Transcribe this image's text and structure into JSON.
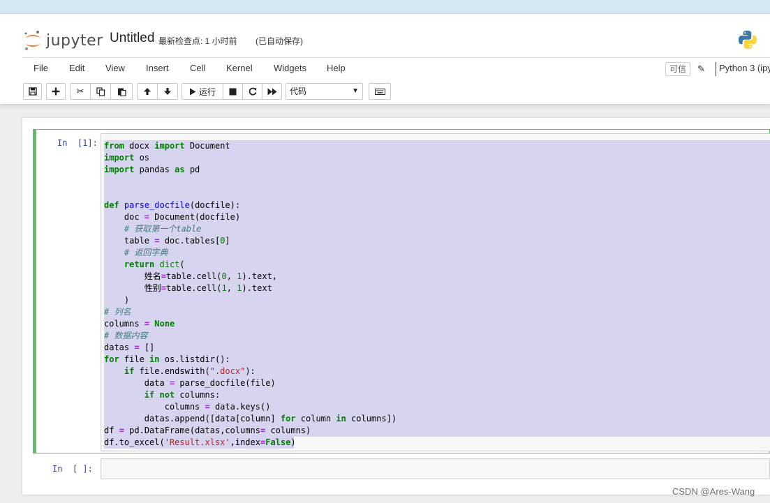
{
  "header": {
    "logo_text": "jupyter",
    "notebook_name": "Untitled",
    "checkpoint": "最新检查点: 1 小时前",
    "autosave": "(已自动保存)"
  },
  "menu": {
    "items": [
      "File",
      "Edit",
      "View",
      "Insert",
      "Cell",
      "Kernel",
      "Widgets",
      "Help"
    ],
    "trusted": "可信",
    "kernel": "Python 3 (ipy"
  },
  "toolbar": {
    "run_label": "运行",
    "cell_type": "代码",
    "icons": [
      "save-icon",
      "add-cell-icon",
      "cut-icon",
      "copy-icon",
      "paste-icon",
      "move-up-icon",
      "move-down-icon",
      "run-icon",
      "stop-icon",
      "restart-icon",
      "fast-forward-icon",
      "keyboard-icon"
    ]
  },
  "cells": [
    {
      "prompt": "In  [1]:",
      "code": [
        "from docx import Document",
        "import os",
        "import pandas as pd",
        "",
        "",
        "def parse_docfile(docfile):",
        "    doc = Document(docfile)",
        "    # 获取第一个table",
        "    table = doc.tables[0]",
        "    # 返回字典",
        "    return dict(",
        "        姓名=table.cell(0, 1).text,",
        "        性别=table.cell(1, 1).text",
        "    )",
        "# 列名",
        "columns = None",
        "# 数据内容",
        "datas = []",
        "for file in os.listdir():",
        "    if file.endswith(\".docx\"):",
        "        data = parse_docfile(file)",
        "        if not columns:",
        "            columns = data.keys()",
        "        datas.append([data[column] for column in columns])",
        "df = pd.DataFrame(datas,columns= columns)",
        "df.to_excel('Result.xlsx',index=False)"
      ]
    },
    {
      "prompt": "In  [ ]:",
      "code": []
    }
  ],
  "watermark": "CSDN @Ares-Wang"
}
